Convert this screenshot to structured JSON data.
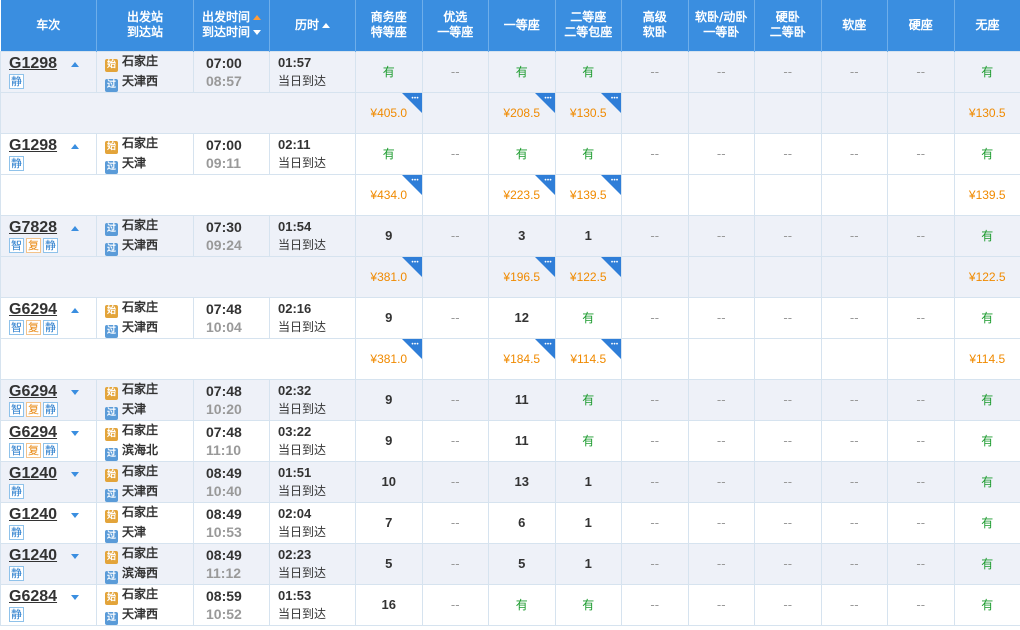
{
  "header": {
    "train": "车次",
    "station_top": "出发站",
    "station_bottom": "到达站",
    "time_top": "出发时间",
    "time_bottom": "到达时间",
    "duration": "历时",
    "seats": [
      [
        "商务座",
        "特等座"
      ],
      [
        "优选",
        "一等座"
      ],
      [
        "一等座",
        ""
      ],
      [
        "二等座",
        "二等包座"
      ],
      [
        "高级",
        "软卧"
      ],
      [
        "软卧/动卧",
        "一等卧"
      ],
      [
        "硬卧",
        "二等卧"
      ],
      [
        "软座",
        ""
      ],
      [
        "硬座",
        ""
      ],
      [
        "无座",
        ""
      ]
    ]
  },
  "labels": {
    "same_day": "当日到达",
    "none": "--",
    "start_icon": "始",
    "pass_icon": "过"
  },
  "trains": [
    {
      "no": "G1298",
      "expand": "up",
      "tags": [
        "静"
      ],
      "from": "石家庄",
      "from_type": "start",
      "to": "天津西",
      "dep": "07:00",
      "arr": "08:57",
      "dur": "01:57",
      "seats": [
        "有",
        "--",
        "有",
        "有",
        "--",
        "--",
        "--",
        "--",
        "--",
        "有"
      ],
      "prices": [
        "¥405.0",
        "",
        "¥208.5",
        "¥130.5",
        "",
        "",
        "",
        "",
        "",
        "¥130.5"
      ]
    },
    {
      "no": "G1298",
      "expand": "up",
      "tags": [
        "静"
      ],
      "from": "石家庄",
      "from_type": "start",
      "to": "天津",
      "dep": "07:00",
      "arr": "09:11",
      "dur": "02:11",
      "seats": [
        "有",
        "--",
        "有",
        "有",
        "--",
        "--",
        "--",
        "--",
        "--",
        "有"
      ],
      "prices": [
        "¥434.0",
        "",
        "¥223.5",
        "¥139.5",
        "",
        "",
        "",
        "",
        "",
        "¥139.5"
      ]
    },
    {
      "no": "G7828",
      "expand": "up",
      "tags": [
        "智",
        "复",
        "静"
      ],
      "from": "石家庄",
      "from_type": "pass",
      "to": "天津西",
      "dep": "07:30",
      "arr": "09:24",
      "dur": "01:54",
      "seats": [
        "9",
        "--",
        "3",
        "1",
        "--",
        "--",
        "--",
        "--",
        "--",
        "有"
      ],
      "prices": [
        "¥381.0",
        "",
        "¥196.5",
        "¥122.5",
        "",
        "",
        "",
        "",
        "",
        "¥122.5"
      ]
    },
    {
      "no": "G6294",
      "expand": "up",
      "tags": [
        "智",
        "复",
        "静"
      ],
      "from": "石家庄",
      "from_type": "start",
      "to": "天津西",
      "dep": "07:48",
      "arr": "10:04",
      "dur": "02:16",
      "seats": [
        "9",
        "--",
        "12",
        "有",
        "--",
        "--",
        "--",
        "--",
        "--",
        "有"
      ],
      "prices": [
        "¥381.0",
        "",
        "¥184.5",
        "¥114.5",
        "",
        "",
        "",
        "",
        "",
        "¥114.5"
      ]
    },
    {
      "no": "G6294",
      "expand": "down",
      "tags": [
        "智",
        "复",
        "静"
      ],
      "from": "石家庄",
      "from_type": "start",
      "to": "天津",
      "dep": "07:48",
      "arr": "10:20",
      "dur": "02:32",
      "seats": [
        "9",
        "--",
        "11",
        "有",
        "--",
        "--",
        "--",
        "--",
        "--",
        "有"
      ]
    },
    {
      "no": "G6294",
      "expand": "down",
      "tags": [
        "智",
        "复",
        "静"
      ],
      "from": "石家庄",
      "from_type": "start",
      "to": "滨海北",
      "dep": "07:48",
      "arr": "11:10",
      "dur": "03:22",
      "seats": [
        "9",
        "--",
        "11",
        "有",
        "--",
        "--",
        "--",
        "--",
        "--",
        "有"
      ]
    },
    {
      "no": "G1240",
      "expand": "down",
      "tags": [
        "静"
      ],
      "from": "石家庄",
      "from_type": "start",
      "to": "天津西",
      "dep": "08:49",
      "arr": "10:40",
      "dur": "01:51",
      "seats": [
        "10",
        "--",
        "13",
        "1",
        "--",
        "--",
        "--",
        "--",
        "--",
        "有"
      ]
    },
    {
      "no": "G1240",
      "expand": "down",
      "tags": [
        "静"
      ],
      "from": "石家庄",
      "from_type": "start",
      "to": "天津",
      "dep": "08:49",
      "arr": "10:53",
      "dur": "02:04",
      "seats": [
        "7",
        "--",
        "6",
        "1",
        "--",
        "--",
        "--",
        "--",
        "--",
        "有"
      ]
    },
    {
      "no": "G1240",
      "expand": "down",
      "tags": [
        "静"
      ],
      "from": "石家庄",
      "from_type": "start",
      "to": "滨海西",
      "dep": "08:49",
      "arr": "11:12",
      "dur": "02:23",
      "seats": [
        "5",
        "--",
        "5",
        "1",
        "--",
        "--",
        "--",
        "--",
        "--",
        "有"
      ]
    },
    {
      "no": "G6284",
      "expand": "down",
      "tags": [
        "静"
      ],
      "from": "石家庄",
      "from_type": "start",
      "to": "天津西",
      "dep": "08:59",
      "arr": "10:52",
      "dur": "01:53",
      "seats": [
        "16",
        "--",
        "有",
        "有",
        "--",
        "--",
        "--",
        "--",
        "--",
        "有"
      ]
    }
  ],
  "colors": {
    "header_bg": "#3a8ee0",
    "yes": "#1a9a2c",
    "price": "#f08a00",
    "shade": "#eef1f8"
  }
}
